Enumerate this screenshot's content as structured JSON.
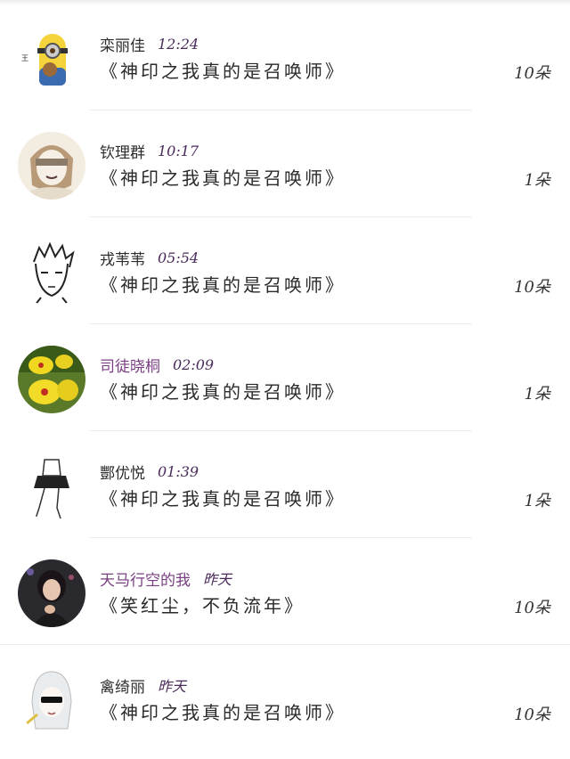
{
  "rows": [
    {
      "name": "栾丽佳",
      "time": "12:24",
      "book": "《神印之我真的是召唤师》",
      "count": "10朵",
      "avatar": "minion-avatar"
    },
    {
      "name": "钦理群",
      "time": "10:17",
      "book": "《神印之我真的是召唤师》",
      "count": "1朵",
      "avatar": "blindfolded-anime-avatar"
    },
    {
      "name": "戎苇苇",
      "time": "05:54",
      "book": "《神印之我真的是召唤师》",
      "count": "10朵",
      "avatar": "sketch-man-avatar"
    },
    {
      "name": "司徒晓桐",
      "time": "02:09",
      "book": "《神印之我真的是召唤师》",
      "count": "1朵",
      "avatar": "yellow-orchid-avatar"
    },
    {
      "name": "酆优悦",
      "time": "01:39",
      "book": "《神印之我真的是召唤师》",
      "count": "1朵",
      "avatar": "sketch-girl-avatar"
    },
    {
      "name": "天马行空的我",
      "time": "昨天",
      "book": "《笑红尘，不负流年》",
      "count": "10朵",
      "avatar": "woman-photo-avatar"
    },
    {
      "name": "禽绮丽",
      "time": "昨天",
      "book": "《神印之我真的是召唤师》",
      "count": "10朵",
      "avatar": "white-hair-sunglasses-avatar"
    }
  ],
  "colors": {
    "accent_pink": "#c0527a",
    "accent_purple": "#7a3f82",
    "divider": "#ececec"
  }
}
